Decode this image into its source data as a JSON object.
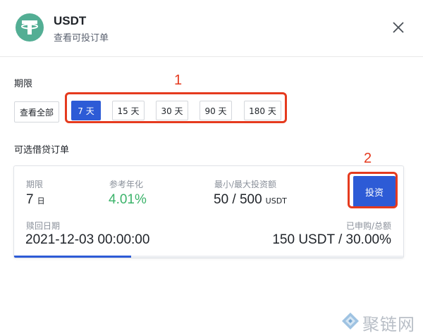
{
  "header": {
    "coin_name": "USDT",
    "subtitle": "查看可投订单",
    "logo_color": "#53ae94",
    "logo_icon": "tether-icon",
    "close_icon": "close-icon"
  },
  "periods": {
    "label": "期限",
    "all_label": "查看全部",
    "options": [
      "7 天",
      "15 天",
      "30 天",
      "90 天",
      "180 天"
    ],
    "selected": "7 天"
  },
  "orders": {
    "label": "可选借贷订单",
    "items": [
      {
        "term_label": "期限",
        "term_value": "7",
        "term_unit": "日",
        "rate_label": "参考年化",
        "rate_value": "4.01%",
        "limit_label": "最小/最大投资额",
        "limit_value": "50 / 500",
        "limit_unit": "USDT",
        "invest_label": "投资",
        "redeem_label": "赎回日期",
        "redeem_value": "2021-12-03 00:00:00",
        "subscribed_label": "已申购/总额",
        "subscribed_value": "150 USDT / 30.00%",
        "progress_percent": 30
      }
    ]
  },
  "annotations": {
    "one": "1",
    "two": "2",
    "color": "#e53a1e"
  },
  "watermark": {
    "text": "聚链网"
  },
  "colors": {
    "accent": "#2d5bd6",
    "positive": "#3bb36a"
  }
}
